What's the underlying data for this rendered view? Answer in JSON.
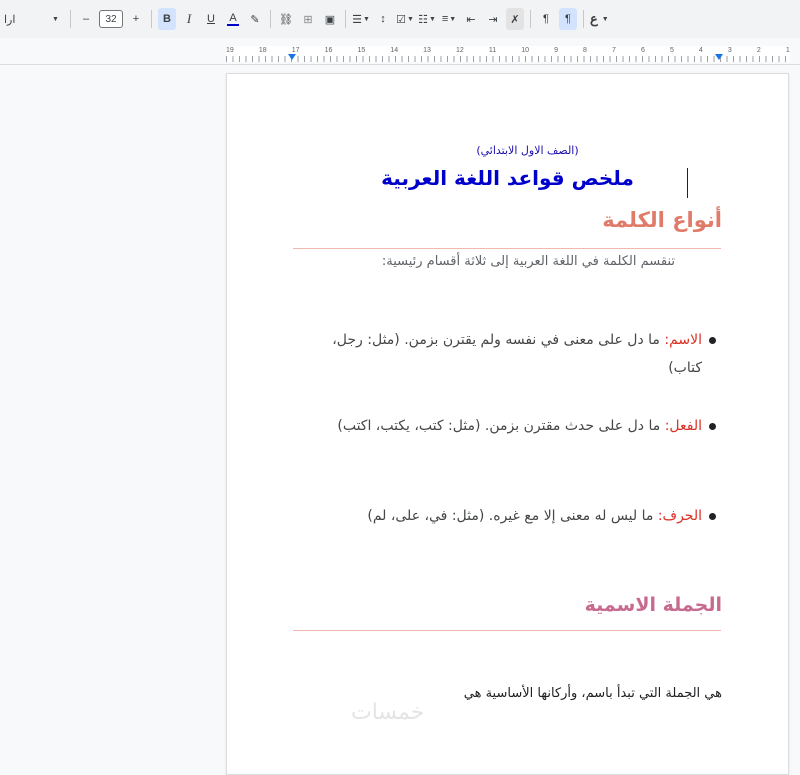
{
  "toolbar": {
    "font_name": "ارا",
    "font_size": "32",
    "decrease": "–",
    "increase": "+",
    "bold": "B",
    "italic": "I",
    "underline": "U",
    "text_color": "A",
    "input_tools": "ع",
    "icons": [
      "pen-icon",
      "link-icon",
      "comment-icon",
      "image-icon",
      "align-icon",
      "line-spacing-icon",
      "checklist-icon",
      "bulleted-list-icon",
      "numbered-list-icon",
      "decrease-indent-icon",
      "increase-indent-icon",
      "clear-formatting-icon",
      "ltr-icon",
      "rtl-icon"
    ]
  },
  "ruler": {
    "numbers": [
      "19",
      "18",
      "17",
      "16",
      "15",
      "14",
      "13",
      "12",
      "11",
      "10",
      "9",
      "8",
      "7",
      "6",
      "5",
      "4",
      "3",
      "2",
      "1"
    ]
  },
  "document": {
    "subtitle": "(الصف الاول الابتدائي)",
    "title": "ملخص قواعد اللغة العربية",
    "heading1": "أنواع الكلمة",
    "intro": "تنقسم الكلمة في اللغة العربية إلى ثلاثة أقسام رئيسية:",
    "bullets": [
      {
        "term": "الاسم:",
        "text": " ما دل على معنى في نفسه ولم يقترن بزمن. (مثل: رجل، كتاب)"
      },
      {
        "term": "الفعل:",
        "text": " ما دل على حدث مقترن بزمن. (مثل: كتب، يكتب، اكتب)"
      },
      {
        "term": "الحرف:",
        "text": " ما ليس له معنى إلا مع غيره. (مثل: في، على، لم)"
      }
    ],
    "heading2": "الجملة الاسمية",
    "last_line": "هي الجملة التي تبدأ باسم، وأركانها الأساسية هي",
    "watermark": "خمسات"
  },
  "colors": {
    "title": "#0000cc",
    "heading1": "#e07b6a",
    "heading2": "#c76a8f",
    "term": "#d93025",
    "active_button": "#d3e3fd"
  }
}
